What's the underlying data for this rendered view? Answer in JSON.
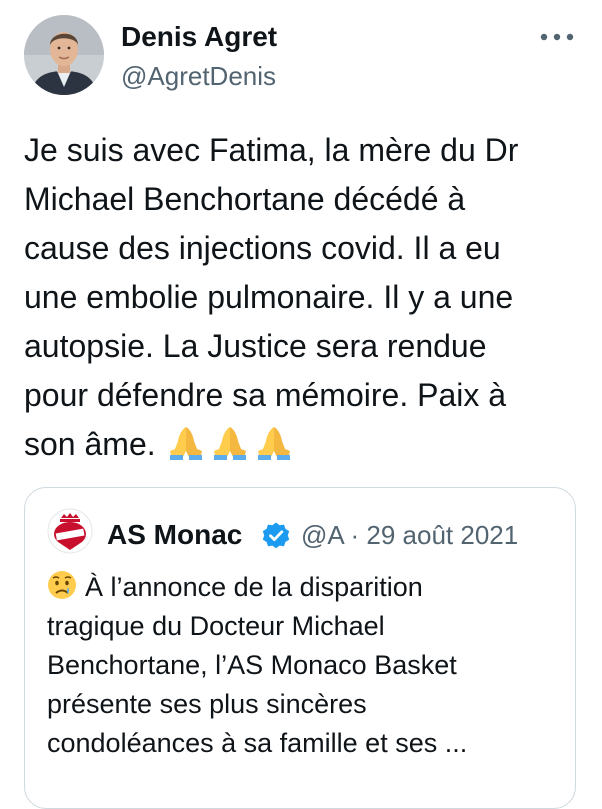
{
  "author": {
    "name": "Denis Agret",
    "handle": "@AgretDenis"
  },
  "tweet": {
    "text": "Je suis avec Fatima, la mère du Dr\nMichael Benchortane décédé à\ncause des injections covid. Il a eu\nune embolie pulmonaire. Il y a une\nautopsie. La Justice sera rendue\npour défendre sa mémoire. Paix à\nson âme.",
    "emojis": [
      "folded-hands",
      "folded-hands",
      "folded-hands"
    ]
  },
  "quote": {
    "name": "AS Monac",
    "verified": true,
    "handle": "@A",
    "separator": "·",
    "date": "29 août 2021",
    "meta": "@A · 29 août 2021",
    "leading_emoji": "crying-face",
    "text": "À l’annonce de la disparition\ntragique du Docteur Michael\nBenchortane, l’AS Monaco Basket\nprésente ses plus sincères\ncondoléances à sa famille et ses ..."
  },
  "colors": {
    "primary_text": "#0f1419",
    "secondary_text": "#536471",
    "border": "#cfd9de",
    "verified_blue": "#1d9bf0",
    "monaco_red": "#c8102e"
  },
  "icons": {
    "more": "more-horizontal-icon",
    "verified": "verified-badge-icon"
  }
}
